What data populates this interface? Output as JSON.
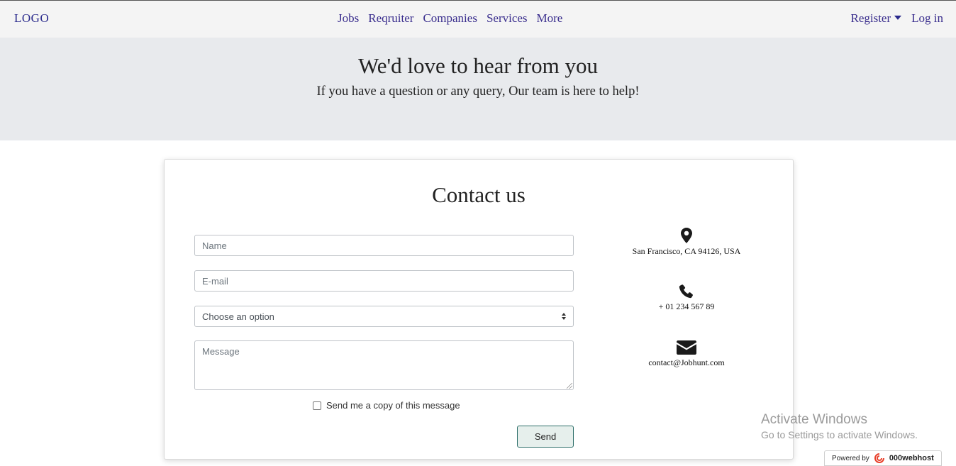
{
  "nav": {
    "logo": "LOGO",
    "links": [
      "Jobs",
      "Reqruiter",
      "Companies",
      "Services",
      "More"
    ],
    "register": "Register",
    "login": "Log in"
  },
  "hero": {
    "title": "We'd love to hear from you",
    "subtitle": "If you have a question or any query, Our team is here to help!"
  },
  "contact": {
    "title": "Contact us",
    "name_placeholder": "Name",
    "email_placeholder": "E-mail",
    "select_value": "Choose an option",
    "message_placeholder": "Message",
    "copy_label": "Send me a copy of this message",
    "send_label": "Send"
  },
  "info": {
    "address": "San Francisco, CA 94126, USA",
    "phone": "+ 01 234 567 89",
    "email": "contact@Jobhunt.com",
    "icons": [
      "map-marker-icon",
      "phone-icon",
      "envelope-icon"
    ]
  },
  "overlay": {
    "activate_title": "Activate Windows",
    "activate_sub": "Go to Settings to activate Windows.",
    "powered_by": "Powered by",
    "host_brand": "000webhost"
  },
  "colors": {
    "nav_text": "#3b2f8e",
    "hero_bg": "#e8eaed",
    "send_border": "#2e6f6a"
  }
}
